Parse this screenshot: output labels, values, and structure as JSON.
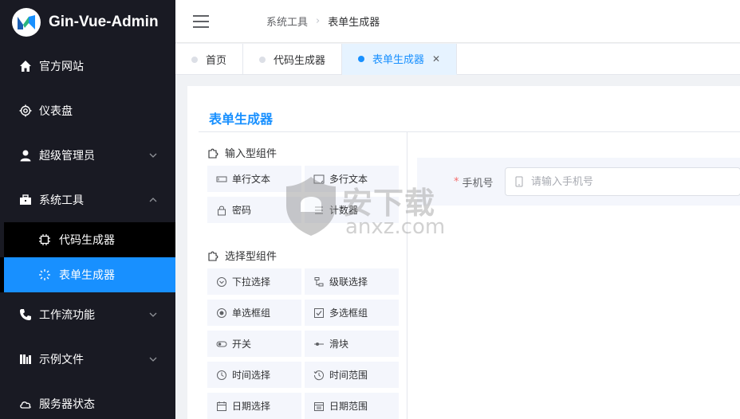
{
  "app": {
    "title": "Gin-Vue-Admin",
    "brand_color": "#1890ff",
    "sidebar_bg": "#191a23"
  },
  "sidebar": {
    "items": [
      {
        "label": "官方网站",
        "icon": "home-icon"
      },
      {
        "label": "仪表盘",
        "icon": "gear-icon"
      },
      {
        "label": "超级管理员",
        "icon": "user-icon",
        "expandable": true
      },
      {
        "label": "系统工具",
        "icon": "toolbox-icon",
        "expanded": true
      },
      {
        "label": "工作流功能",
        "icon": "phone-icon",
        "expandable": true
      },
      {
        "label": "示例文件",
        "icon": "folder-icon",
        "expandable": true
      },
      {
        "label": "服务器状态",
        "icon": "cloud-icon"
      }
    ],
    "submenu": [
      {
        "label": "代码生成器",
        "icon": "cpu-icon"
      },
      {
        "label": "表单生成器",
        "icon": "loading-icon",
        "active": true
      }
    ]
  },
  "header": {
    "breadcrumb": [
      "系统工具",
      "表单生成器"
    ]
  },
  "tabs": [
    {
      "label": "首页"
    },
    {
      "label": "代码生成器"
    },
    {
      "label": "表单生成器",
      "active": true,
      "closable": true
    }
  ],
  "panel": {
    "title": "表单生成器",
    "groups": [
      {
        "title": "输入型组件",
        "components": [
          {
            "label": "单行文本",
            "icon": "input-icon"
          },
          {
            "label": "多行文本",
            "icon": "textarea-icon"
          },
          {
            "label": "密码",
            "icon": "lock-icon"
          },
          {
            "label": "计数器",
            "icon": "counter-icon"
          }
        ]
      },
      {
        "title": "选择型组件",
        "components": [
          {
            "label": "下拉选择",
            "icon": "select-icon"
          },
          {
            "label": "级联选择",
            "icon": "cascader-icon"
          },
          {
            "label": "单选框组",
            "icon": "radio-icon"
          },
          {
            "label": "多选框组",
            "icon": "checkbox-icon"
          },
          {
            "label": "开关",
            "icon": "switch-icon"
          },
          {
            "label": "滑块",
            "icon": "slider-icon"
          },
          {
            "label": "时间选择",
            "icon": "clock-icon"
          },
          {
            "label": "时间范围",
            "icon": "time-range-icon"
          },
          {
            "label": "日期选择",
            "icon": "calendar-icon"
          },
          {
            "label": "日期范围",
            "icon": "date-range-icon"
          }
        ]
      }
    ],
    "form_field": {
      "required_mark": "*",
      "label": "手机号",
      "placeholder": "请输入手机号",
      "value": ""
    }
  },
  "watermark": {
    "text_cn": "安下载",
    "text_en": "anxz.com"
  }
}
